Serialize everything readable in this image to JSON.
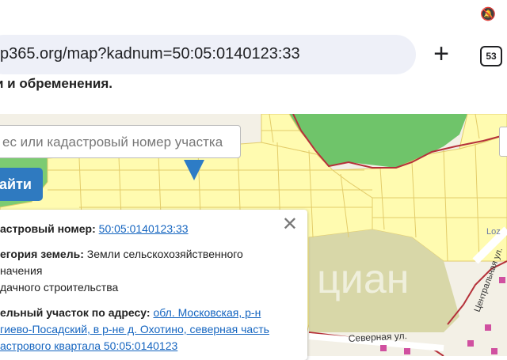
{
  "browser": {
    "url": "p365.org/map?kadnum=50:05:0140123:33",
    "tab_count": "53"
  },
  "page": {
    "heading_fragment": "и и обременения."
  },
  "map": {
    "watermark": "циан",
    "street_label": "Северная ул.",
    "street_label_2": "Центральная ул.",
    "corner_label": "Loz"
  },
  "search": {
    "placeholder": "ес или кадастровый номер участка",
    "find_label": "айти"
  },
  "popup": {
    "cadnum_label": "астровый номер:",
    "cadnum_value": "50:05:0140123:33",
    "category_label": "егория земель:",
    "category_value_1": "Земли сельскохозяйственного",
    "category_value_2": "начения",
    "category_value_3": "дачного строительства",
    "address_label": "ельный участок по адресу:",
    "address_link_1": "обл. Московская, р-н",
    "address_link_2": "гиево-Посадский, в р-не д. Охотино, северная часть",
    "address_link_3": "астрового квартала 50:05:0140123"
  },
  "colors": {
    "accent": "#2f7ac0",
    "parcel_fill": "#fffbb0",
    "parcel_line": "#e3cc6a",
    "forest": "#6fc46a",
    "boundary": "#b5313a"
  }
}
